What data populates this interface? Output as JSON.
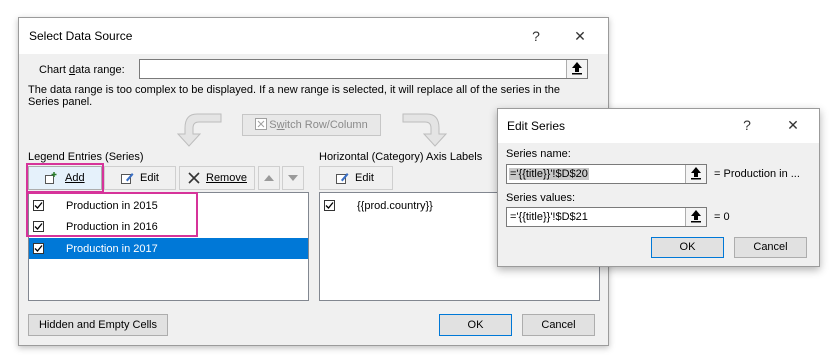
{
  "dialog": {
    "title": "Select Data Source",
    "help": "?",
    "close": "✕",
    "chart_range_label_pre": "Chart ",
    "chart_range_label_ul": "d",
    "chart_range_label_post": "ata range:",
    "chart_range_value": "",
    "warning_line1": "The data range is too complex to be displayed. If a new range is selected, it will replace all of the series in the",
    "warning_line2": "Series panel.",
    "switch_label_pre": "S",
    "switch_label_ul": "w",
    "switch_label_post": "itch Row/Column",
    "legend_label": "Legend Entries (Series)",
    "axis_label": "Horizontal (Category) Axis Labels",
    "add_label": "Add",
    "edit_label": "Edit",
    "remove_label": "Remove",
    "axis_edit_label": "Edit",
    "series": [
      {
        "label": "Production in 2015",
        "checked": true
      },
      {
        "label": "Production in 2016",
        "checked": true
      },
      {
        "label": "Production in 2017",
        "checked": true
      }
    ],
    "categories": [
      {
        "label": "{{prod.country}}",
        "checked": true
      }
    ],
    "hidden_cells_label": "Hidden and Empty Cells",
    "ok_label": "OK",
    "cancel_label": "Cancel"
  },
  "edit_series": {
    "title": "Edit Series",
    "help": "?",
    "close": "✕",
    "name_label": "Series name:",
    "name_value": "='{{title}}'!$D$20",
    "name_preview": "= Production in ...",
    "values_label": "Series values:",
    "values_value": "='{{title}}'!$D$21",
    "values_preview": "= 0",
    "ok_label": "OK",
    "cancel_label": "Cancel"
  },
  "colors": {
    "selection": "#0078d7",
    "highlight": "#d6339a",
    "dialog_bg": "#f0f0f0"
  }
}
